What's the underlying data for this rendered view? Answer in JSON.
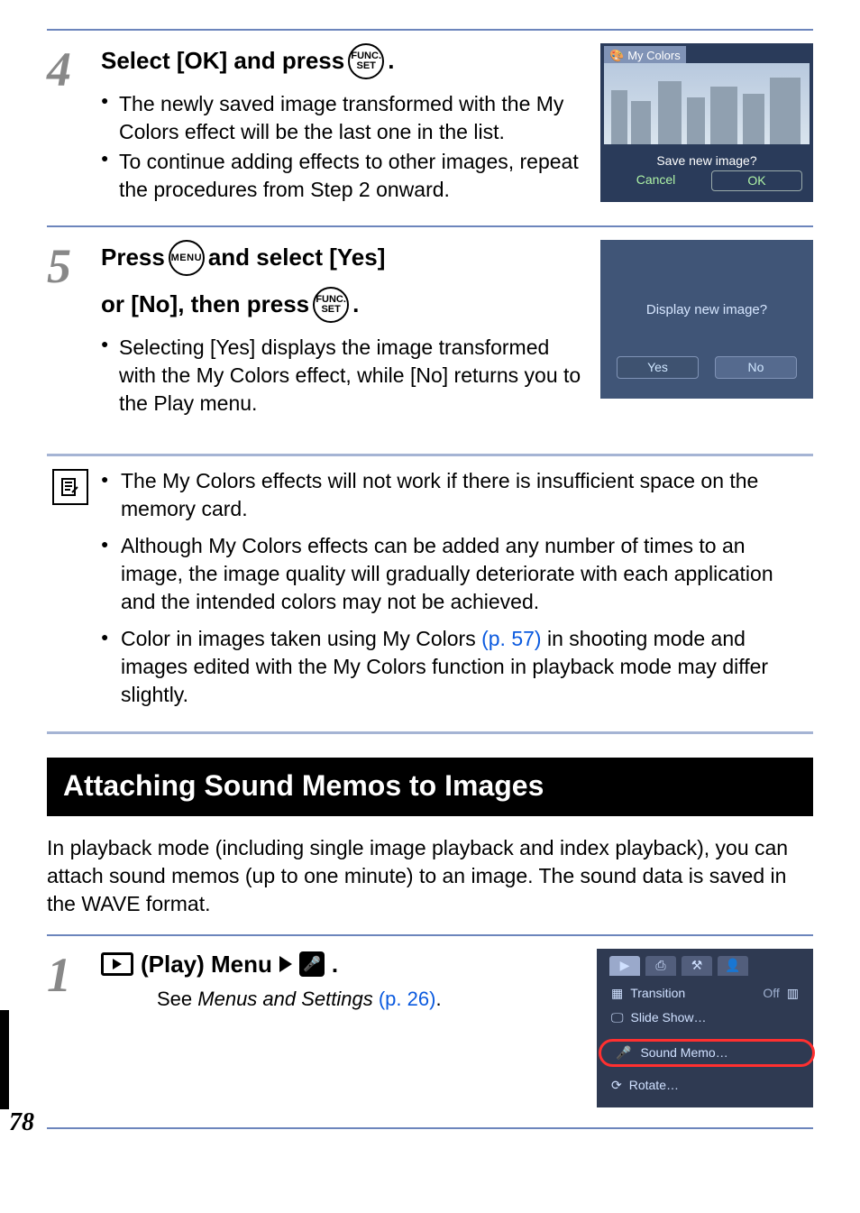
{
  "step4": {
    "number": "4",
    "heading_prefix": "Select [OK] and press ",
    "heading_suffix": ".",
    "func_icon_top": "FUNC.",
    "func_icon_bottom": "SET",
    "bullet1": "The newly saved image transformed with the My Colors effect will be the last one in the list.",
    "bullet2": "To continue adding effects to other images, repeat the procedures from Step 2 onward.",
    "screen": {
      "title": "My Colors",
      "prompt": "Save new image?",
      "cancel": "Cancel",
      "ok": "OK"
    }
  },
  "step5": {
    "number": "5",
    "heading_part1": "Press ",
    "menu_label": "MENU",
    "heading_part2": " and select [Yes]",
    "heading_part3": "or [No], then press ",
    "heading_suffix": ".",
    "func_icon_top": "FUNC.",
    "func_icon_bottom": "SET",
    "bullet1": "Selecting [Yes] displays the image transformed with the My Colors effect, while [No] returns you to the Play menu.",
    "screen": {
      "prompt": "Display new image?",
      "yes": "Yes",
      "no": "No"
    }
  },
  "info": {
    "note1": "The My Colors effects will not work if there is insufficient space on the memory card.",
    "note2": "Although My Colors effects can be added any number of times to an image, the image quality will gradually deteriorate with each application and the intended colors may not be achieved.",
    "note3_pre": "Color in images taken using My Colors ",
    "note3_link": "(p. 57)",
    "note3_post": " in shooting mode and images edited with the My Colors function in playback mode may differ slightly."
  },
  "section": {
    "title": "Attaching Sound Memos to Images",
    "intro": "In playback mode (including single image playback and index playback), you can attach sound memos (up to one minute) to an image. The sound data is saved in the WAVE format."
  },
  "step1": {
    "number": "1",
    "heading_mid": " (Play) Menu",
    "heading_suffix": ".",
    "see_pre": "See ",
    "see_em": "Menus and Settings",
    "see_link": " (p. 26)",
    "see_post": ".",
    "menu_items": {
      "transition": "Transition",
      "transition_value": "Off",
      "slide_show": "Slide Show…",
      "sound_memo": "Sound Memo…",
      "rotate": "Rotate…"
    }
  },
  "page_number": "78"
}
